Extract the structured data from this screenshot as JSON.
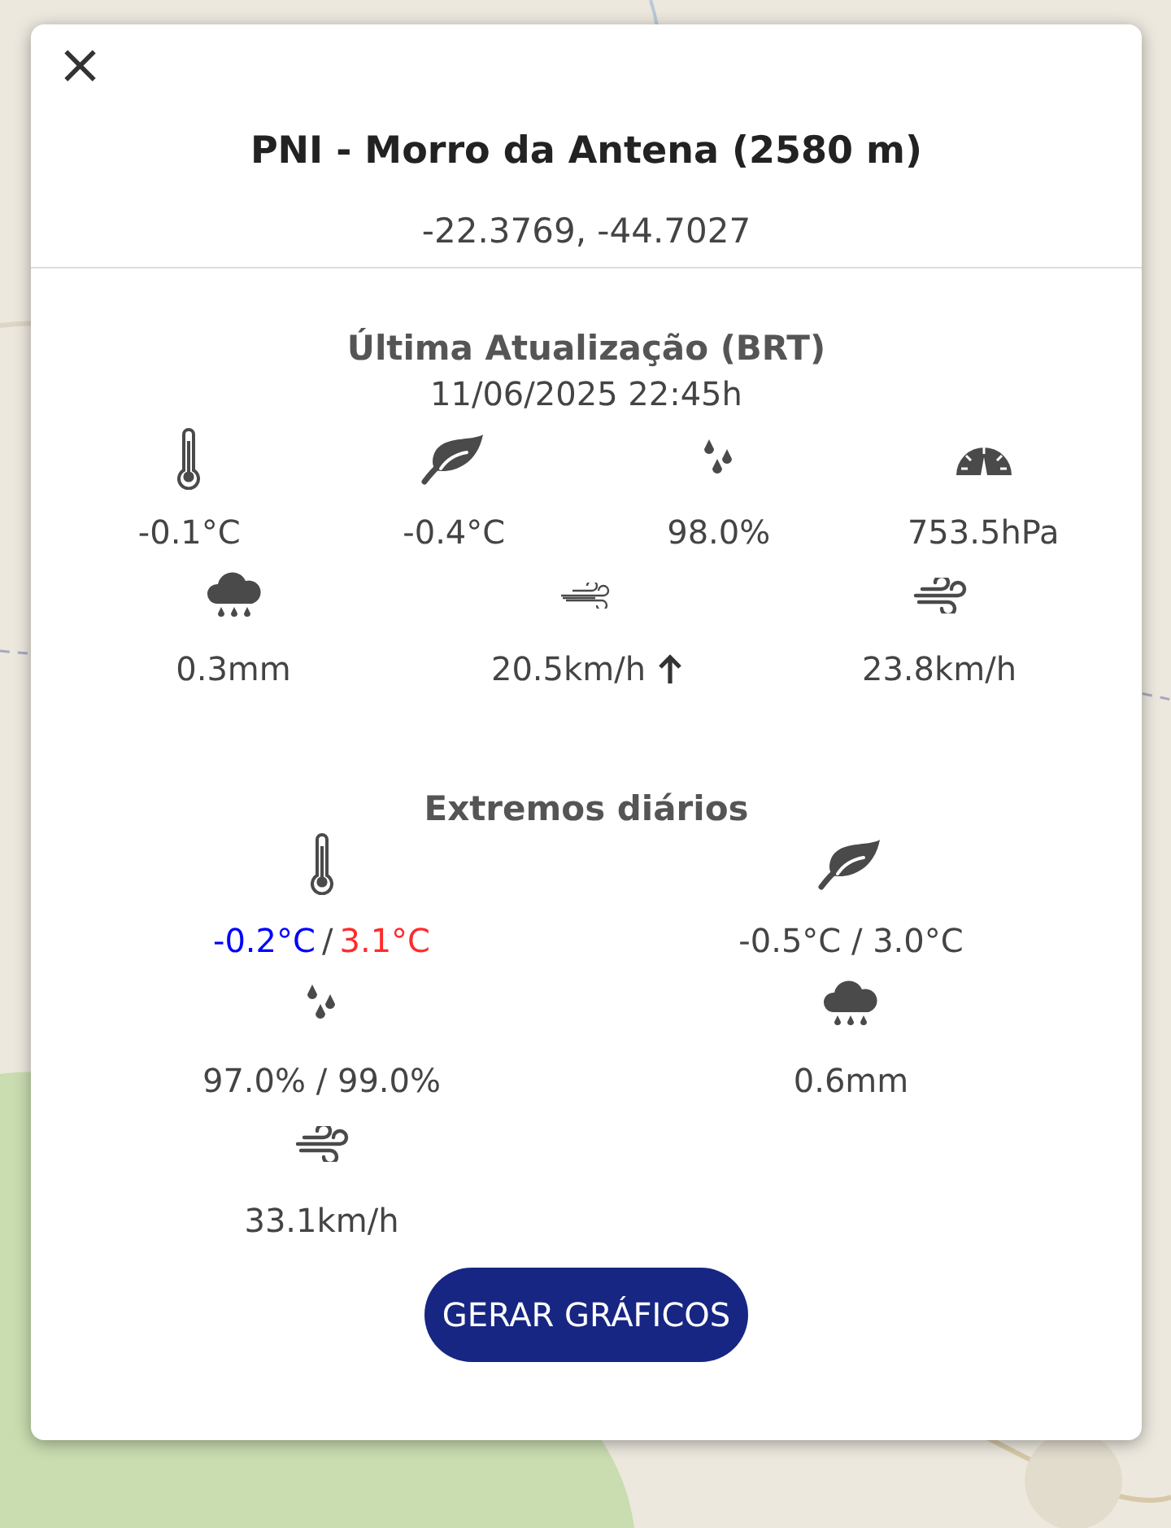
{
  "popup": {
    "close": "×",
    "title": "PNI - Morro da Antena (2580 m)",
    "coordinates": "-22.3769, -44.7027"
  },
  "current": {
    "heading": "Última Atualização (BRT)",
    "timestamp": "11/06/2025 22:45h",
    "items": [
      {
        "kind": "thermometer",
        "value": "-0.1°C"
      },
      {
        "kind": "leaf",
        "value": "-0.4°C"
      },
      {
        "kind": "drops",
        "value": "98.0%"
      },
      {
        "kind": "gauge",
        "value": "753.5hPa"
      },
      {
        "kind": "rain",
        "value": "0.3mm"
      },
      {
        "kind": "breeze",
        "value": "20.5km/h",
        "direction_arrow": true
      },
      {
        "kind": "wind",
        "value": "23.8km/h"
      }
    ]
  },
  "extremes": {
    "heading": "Extremos diários",
    "items": [
      {
        "kind": "thermometer",
        "parts": [
          {
            "text": "-0.2°C",
            "color": "#0000ff"
          },
          {
            "text": "/"
          },
          {
            "text": "3.1°C",
            "color": "#ff2b2b"
          }
        ]
      },
      {
        "kind": "leaf",
        "parts": [
          {
            "text": "-0.5°C / 3.0°C"
          }
        ]
      },
      {
        "kind": "drops",
        "parts": [
          {
            "text": "97.0% / 99.0%"
          }
        ]
      },
      {
        "kind": "rain",
        "parts": [
          {
            "text": "0.6mm"
          }
        ]
      },
      {
        "kind": "wind",
        "parts": [
          {
            "text": "33.1km/h"
          }
        ]
      }
    ]
  },
  "button": "GERAR GRÁFICOS"
}
